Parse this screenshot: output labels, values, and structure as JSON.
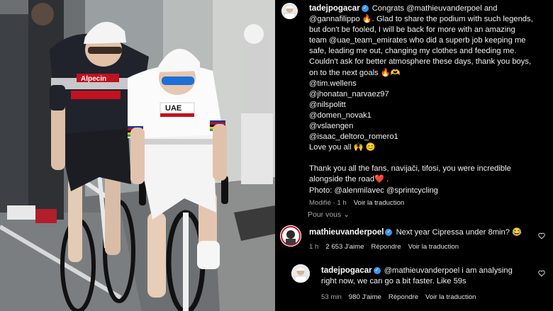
{
  "post": {
    "username": "tadejpogacar",
    "caption_lines": [
      "Congrats @mathieuvanderpoel and",
      "@gannafilippo 🔥. Glad to share the podium with such legends,",
      "but don't be fooled, I will be back for more with an amazing",
      "team @uae_team_emirates who did a superb job keeping me",
      "safe, leading me out, changing my clothes and feeding me.",
      "Couldn't ask for better atmosphere these days, thank you boys,",
      "on to the next goals 🔥🫶",
      "@tim.wellens",
      "@jhonatan_narvaez97",
      "@nilspolitt",
      "@domen_novak1",
      "@vslaengen",
      "@isaac_deltoro_romero1",
      "Love you all 🙌 😊",
      "Thank you all the fans, navijači, tifosi, you were incredible",
      "alongside the road❤️ .",
      "Photo: @alenmilavec @sprintcycling"
    ],
    "meta": {
      "time": "Modifié · 1 h",
      "translate": "Voir la traduction"
    }
  },
  "pour_vous": "Pour vous ⌄",
  "comments": [
    {
      "username": "mathieuvanderpoel",
      "text": "Next year Cipressa under 8min? 😂",
      "time": "1 h",
      "likes": "2 653 J'aime",
      "reply": "Répondre",
      "translate": "Voir la traduction"
    },
    {
      "username": "tadejpogacar",
      "text_line1": "@mathieuvanderpoel i am analysing",
      "text_line2": "right now, we can go a bit faster. Like 59s",
      "time": "53 min",
      "likes": "980 J'aime",
      "reply": "Répondre",
      "translate": "Voir la traduction"
    }
  ],
  "photo_text": {
    "rider1_sponsor": "Alpecin",
    "rider2_team": "UAE"
  }
}
